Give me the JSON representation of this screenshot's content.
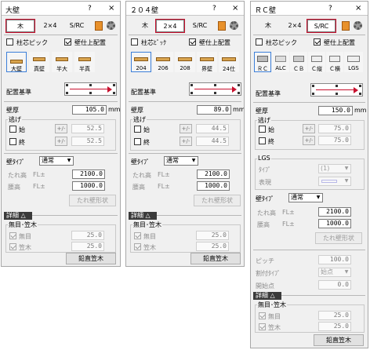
{
  "panels": {
    "p1": {
      "title": "大壁",
      "help": "?",
      "close": "×",
      "tabs": [
        "木",
        "2×4",
        "S/RC"
      ],
      "col_pick": "柱芯ピック",
      "wall_top": "壁仕上配置",
      "icons": [
        "大壁",
        "真壁",
        "半大",
        "半真"
      ],
      "base_label": "配置基準",
      "thickness_label": "壁厚",
      "thickness_value": "105.0",
      "unit": "mm",
      "nige_label": "逃げ",
      "start_label": "始",
      "end_label": "終",
      "pm": "+/-",
      "nige_start": "52.5",
      "nige_end": "52.5",
      "wall_type_label": "壁ﾀｲﾌﾟ",
      "wall_type": "通常",
      "tare_label": "たれ高",
      "koshi_label": "腰高",
      "fl": "FL±",
      "tare_value": "2100.0",
      "koshi_value": "1000.0",
      "tare_button": "たれ壁形状",
      "details": "詳細",
      "frame_title": "無目･笠木",
      "mume": "無目",
      "kasagi": "笠木",
      "mume_value": "25.0",
      "kasagi_value": "25.0",
      "vert_button": "鉛直笠木"
    },
    "p2": {
      "title": "２０４壁",
      "help": "?",
      "close": "×",
      "tabs": [
        "木",
        "2×4",
        "S/RC"
      ],
      "col_pick": "柱芯ﾋﾟｯｸ",
      "wall_top": "壁仕上配置",
      "icons": [
        "204",
        "206",
        "208",
        "界壁",
        "24仕"
      ],
      "base_label": "配置基準",
      "thickness_label": "壁厚",
      "thickness_value": "89.0",
      "unit": "mm",
      "nige_label": "逃げ",
      "start_label": "始",
      "end_label": "終",
      "pm": "+/-",
      "nige_start": "44.5",
      "nige_end": "44.5",
      "wall_type_label": "壁ﾀｲﾌﾟ",
      "wall_type": "通常",
      "tare_label": "たれ高",
      "koshi_label": "腰高",
      "fl": "FL±",
      "tare_value": "2100.0",
      "koshi_value": "1000.0",
      "tare_button": "たれ壁形状",
      "details": "詳細",
      "frame_title": "無目･笠木",
      "mume": "無目",
      "kasagi": "笠木",
      "mume_value": "25.0",
      "kasagi_value": "25.0",
      "vert_button": "鉛直笠木"
    },
    "p3": {
      "title": "ＲＣ壁",
      "help": "?",
      "close": "×",
      "tabs": [
        "木",
        "2×4",
        "S/RC"
      ],
      "col_pick": "柱芯ピック",
      "wall_top": "壁仕上配置",
      "icons": [
        "ＲＣ",
        "ALC",
        "ＣＢ",
        "Ｃ縦",
        "Ｃ横",
        "LGS"
      ],
      "base_label": "配置基準",
      "thickness_label": "壁厚",
      "thickness_value": "150.0",
      "unit": "mm",
      "nige_label": "逃げ",
      "start_label": "始",
      "end_label": "終",
      "pm": "+/-",
      "nige_start": "75.0",
      "nige_end": "75.0",
      "lgs_title": "LGS",
      "type_label": "ﾀｲﾌﾟ",
      "type_value": "(1)",
      "surface_label": "表現",
      "wall_type_label": "壁ﾀｲﾌﾟ",
      "wall_type": "通常",
      "tare_label": "たれ高",
      "koshi_label": "腰高",
      "fl": "FL±",
      "tare_value": "2100.0",
      "koshi_value": "1000.0",
      "tare_button": "たれ壁形状",
      "pitch_label": "ピッチ",
      "pitch_value": "100.0",
      "split_label": "割付ﾀｲﾌﾟ",
      "split_value": "始点",
      "start_pt_label": "開始点",
      "start_pt_value": "0.0",
      "details": "詳細",
      "frame_title": "無目･笠木",
      "mume": "無目",
      "kasagi": "笠木",
      "mume_value": "25.0",
      "kasagi_value": "25.0",
      "vert_button": "鉛直笠木"
    }
  }
}
